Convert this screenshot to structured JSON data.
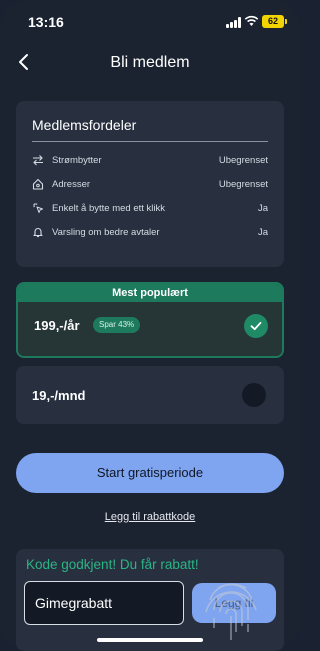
{
  "status_bar": {
    "time": "13:16",
    "battery": "62"
  },
  "header": {
    "title": "Bli medlem"
  },
  "benefits": {
    "title": "Medlemsfordeler",
    "items": [
      {
        "icon": "swap-arrows-icon",
        "label": "Strømbytter",
        "value": "Ubegrenset"
      },
      {
        "icon": "house-icon",
        "label": "Adresser",
        "value": "Ubegrenset"
      },
      {
        "icon": "sparkle-click-icon",
        "label": "Enkelt å bytte med ett klikk",
        "value": "Ja"
      },
      {
        "icon": "bell-icon",
        "label": "Varsling om bedre avtaler",
        "value": "Ja"
      }
    ]
  },
  "plans": {
    "popular_banner": "Mest populært",
    "yearly": {
      "price": "199,-/år",
      "badge": "Spar 43%",
      "selected": true
    },
    "monthly": {
      "price": "19,-/mnd",
      "selected": false
    }
  },
  "cta": {
    "label": "Start gratisperiode"
  },
  "discount_link": "Legg til rabattkode",
  "promo": {
    "success_message": "Kode godkjent! Du får rabatt!",
    "code_value": "Gimegrabatt",
    "apply_label": "Legg til"
  },
  "colors": {
    "accent_green": "#1e7a5c",
    "button_blue": "#7fa4f0",
    "background": "#1b2230"
  }
}
